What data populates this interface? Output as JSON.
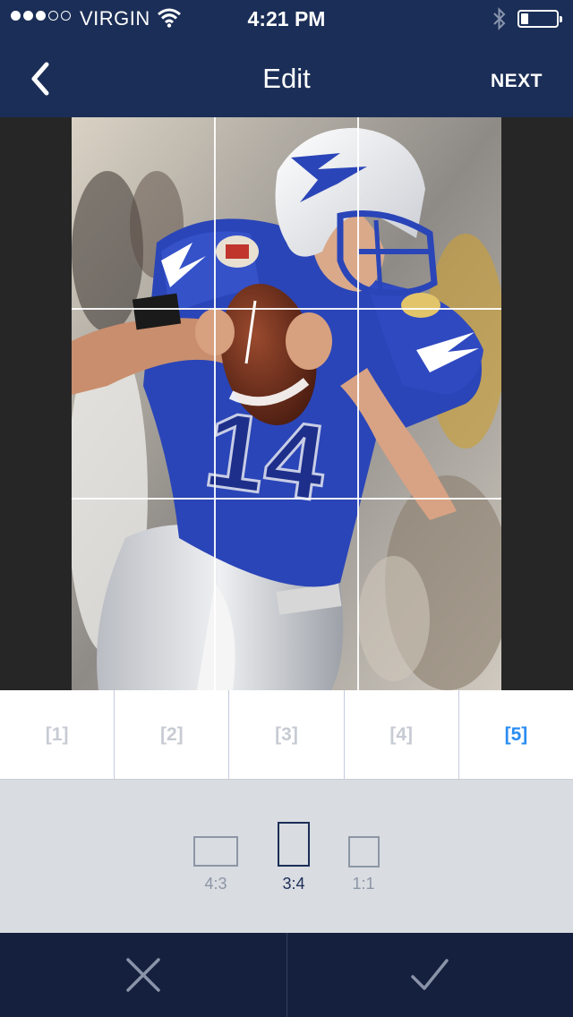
{
  "status_bar": {
    "signal_dots_filled": 3,
    "signal_dots_total": 5,
    "carrier": "VIRGIN",
    "time": "4:21 PM",
    "battery_level": 0.2,
    "icons": [
      "wifi-icon",
      "bluetooth-icon",
      "battery-icon"
    ]
  },
  "nav": {
    "title": "Edit",
    "next_label": "NEXT",
    "back_icon": "chevron-left-icon"
  },
  "photo": {
    "jersey_number": "14",
    "grid": "3x3"
  },
  "frames": [
    {
      "label": "[1]",
      "active": false
    },
    {
      "label": "[2]",
      "active": false
    },
    {
      "label": "[3]",
      "active": false
    },
    {
      "label": "[4]",
      "active": false
    },
    {
      "label": "[5]",
      "active": true
    }
  ],
  "ratios": [
    {
      "label": "4:3",
      "active": false
    },
    {
      "label": "3:4",
      "active": true
    },
    {
      "label": "1:1",
      "active": false
    }
  ],
  "actions": {
    "cancel_icon": "close-icon",
    "confirm_icon": "checkmark-icon"
  },
  "colors": {
    "nav_bar": "#1b2e57",
    "bottom_bar": "#14203d",
    "active_frame": "#2a8df2",
    "inactive_frame": "#c7cbd3"
  }
}
